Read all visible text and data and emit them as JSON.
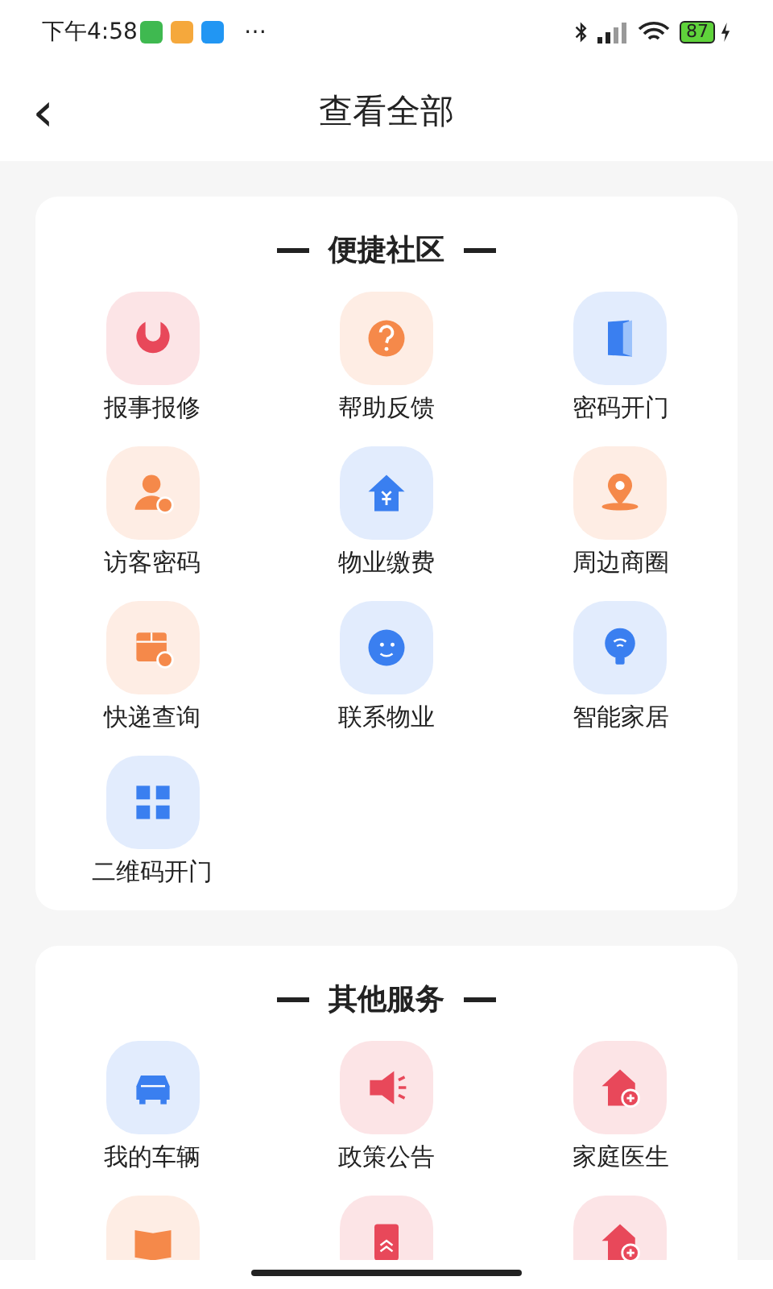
{
  "status_bar": {
    "time": "下午4:58",
    "more": "⋯",
    "battery": "87"
  },
  "header": {
    "back": "‹",
    "title": "查看全部"
  },
  "sections": [
    {
      "title": "便捷社区",
      "items": [
        {
          "label": "报事报修",
          "color": "#e8485a"
        },
        {
          "label": "帮助反馈",
          "color": "#f5894a"
        },
        {
          "label": "密码开门",
          "color": "#3a7ff0"
        },
        {
          "label": "访客密码",
          "color": "#f5894a"
        },
        {
          "label": "物业缴费",
          "color": "#3a7ff0"
        },
        {
          "label": "周边商圈",
          "color": "#f5894a"
        },
        {
          "label": "快递查询",
          "color": "#f5894a"
        },
        {
          "label": "联系物业",
          "color": "#3a7ff0"
        },
        {
          "label": "智能家居",
          "color": "#3a7ff0"
        },
        {
          "label": "二维码开门",
          "color": "#3a7ff0"
        }
      ]
    },
    {
      "title": "其他服务",
      "items": [
        {
          "label": "我的车辆",
          "color": "#3a7ff0"
        },
        {
          "label": "政策公告",
          "color": "#e8485a"
        },
        {
          "label": "家庭医生",
          "color": "#e8485a"
        },
        {
          "color": "#f5894a"
        },
        {
          "color": "#e8485a"
        },
        {
          "color": "#e8485a"
        }
      ]
    }
  ]
}
